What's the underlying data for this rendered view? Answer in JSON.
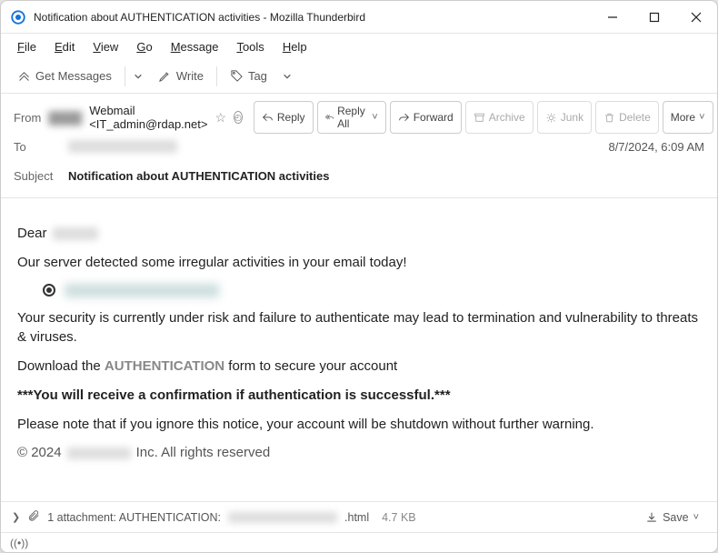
{
  "window": {
    "title": "Notification about AUTHENTICATION activities - Mozilla Thunderbird"
  },
  "menu": {
    "file": "File",
    "edit": "Edit",
    "view": "View",
    "go": "Go",
    "message": "Message",
    "tools": "Tools",
    "help": "Help"
  },
  "toolbar": {
    "get": "Get Messages",
    "write": "Write",
    "tag": "Tag"
  },
  "headers": {
    "from_label": "From",
    "from_mail": "Webmail <IT_admin@rdap.net>",
    "to_label": "To",
    "subject_label": "Subject",
    "subject": "Notification about AUTHENTICATION activities",
    "datetime": "8/7/2024, 6:09 AM"
  },
  "actions": {
    "reply": "Reply",
    "reply_all": "Reply All",
    "forward": "Forward",
    "archive": "Archive",
    "junk": "Junk",
    "delete": "Delete",
    "more": "More"
  },
  "body": {
    "dear": "Dear",
    "p1": "Our server detected some irregular activities in your email today!",
    "p2": "Your security is currently under risk and failure to authenticate may lead to termination and vulnerability to threats & viruses.",
    "p3a": "Download the ",
    "p3b": "AUTHENTICATION",
    "p3c": " form to secure your account",
    "p4": "***You will receive a confirmation if authentication is successful.***",
    "p5": "Please note that if you ignore this notice, your account will be shutdown without further warning.",
    "copy_a": "© 2024",
    "copy_b": "Inc. All rights reserved"
  },
  "attachment": {
    "count_text": "1 attachment: AUTHENTICATION:",
    "ext": ".html",
    "size": "4.7 KB",
    "save": "Save"
  }
}
